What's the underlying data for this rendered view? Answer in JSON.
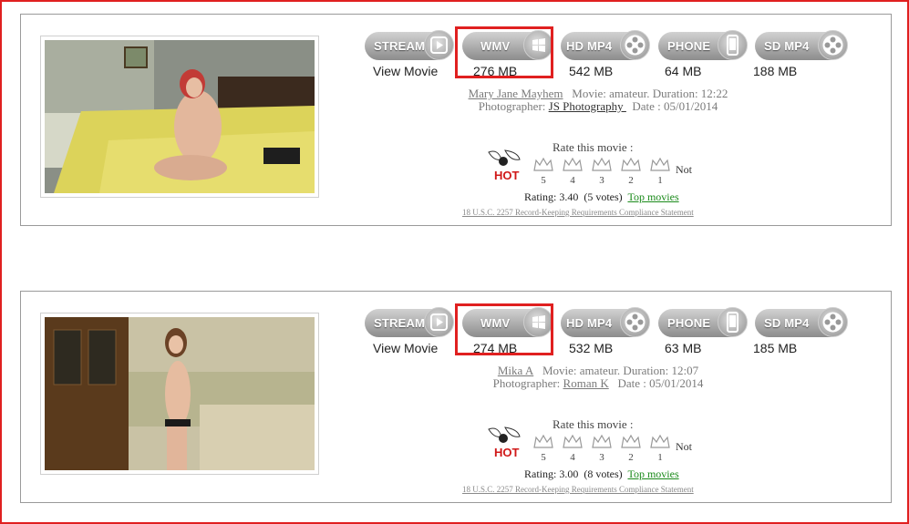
{
  "colors": {
    "highlight": "#e02020",
    "link_green": "#1a8a1a",
    "button_gray": "#a6a6a6"
  },
  "movies": [
    {
      "buttons": [
        {
          "label": "STREAM",
          "icon": "play-icon",
          "size": "View Movie"
        },
        {
          "label": "WMV",
          "icon": "windows-logo-icon",
          "size": "276 MB"
        },
        {
          "label": "HD MP4",
          "icon": "film-reel-icon",
          "size": "542 MB"
        },
        {
          "label": "PHONE",
          "icon": "phone-icon",
          "size": "64 MB"
        },
        {
          "label": "SD MP4",
          "icon": "film-reel-icon",
          "size": "188 MB"
        }
      ],
      "model": "Mary Jane Mayhem",
      "movie_info": "Movie: amateur. Duration: 12:22",
      "photographer_label": "Photographer:",
      "photographer": "JS Photography ",
      "date": "Date : 05/01/2014",
      "rate_title": "Rate this movie :",
      "hot_label": "HOT",
      "stars": [
        "5",
        "4",
        "3",
        "2",
        "1"
      ],
      "not_label": "Not",
      "rating_text": "Rating: 3.40",
      "votes_text": "(5 votes)",
      "top_link": "Top movies",
      "legal": "18 U.S.C. 2257 Record-Keeping Requirements Compliance Statement"
    },
    {
      "buttons": [
        {
          "label": "STREAM",
          "icon": "play-icon",
          "size": "View Movie"
        },
        {
          "label": "WMV",
          "icon": "windows-logo-icon",
          "size": "274 MB"
        },
        {
          "label": "HD MP4",
          "icon": "film-reel-icon",
          "size": "532 MB"
        },
        {
          "label": "PHONE",
          "icon": "phone-icon",
          "size": "63 MB"
        },
        {
          "label": "SD MP4",
          "icon": "film-reel-icon",
          "size": "185 MB"
        }
      ],
      "model": "Mika A",
      "movie_info": "Movie: amateur. Duration: 12:07",
      "photographer_label": "Photographer:",
      "photographer": "Roman K",
      "date": "Date : 05/01/2014",
      "rate_title": "Rate this movie :",
      "hot_label": "HOT",
      "stars": [
        "5",
        "4",
        "3",
        "2",
        "1"
      ],
      "not_label": "Not",
      "rating_text": "Rating: 3.00",
      "votes_text": "(8 votes)",
      "top_link": "Top movies",
      "legal": "18 U.S.C. 2257 Record-Keeping Requirements Compliance Statement"
    }
  ]
}
